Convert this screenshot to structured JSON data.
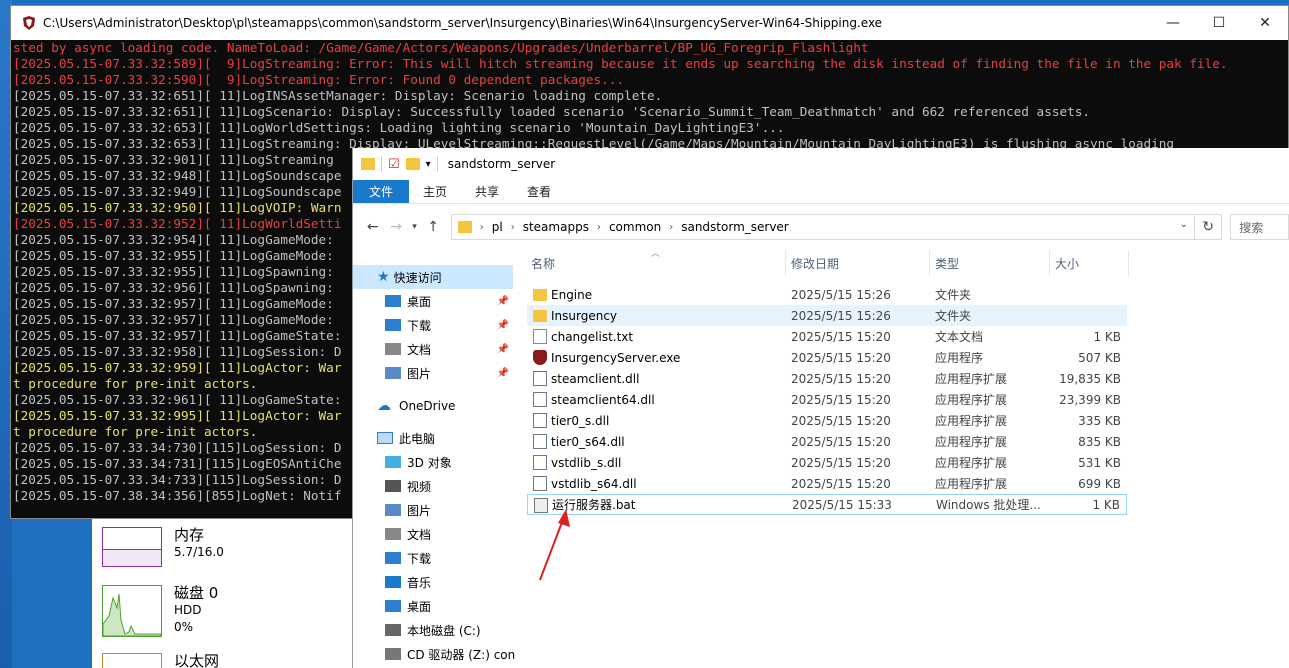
{
  "console": {
    "title": "C:\\Users\\Administrator\\Desktop\\pl\\steamapps\\common\\sandstorm_server\\Insurgency\\Binaries\\Win64\\InsurgencyServer-Win64-Shipping.exe",
    "lines": [
      {
        "t": "sted by async loading code. NameToLoad: /Game/Game/Actors/Weapons/Upgrades/Underbarrel/BP_UG_Foregrip_Flashlight",
        "c": "red"
      },
      {
        "t": "[2025.05.15-07.33.32:589][  9]LogStreaming: Error: This will hitch streaming because it ends up searching the disk instead of finding the file in the pak file.",
        "c": "red"
      },
      {
        "t": "[2025.05.15-07.33.32:590][  9]LogStreaming: Error: Found 0 dependent packages...",
        "c": "red"
      },
      {
        "t": "[2025.05.15-07.33.32:651][ 11]LogINSAssetManager: Display: Scenario loading complete.",
        "c": "white"
      },
      {
        "t": "[2025.05.15-07.33.32:651][ 11]LogScenario: Display: Successfully loaded scenario 'Scenario_Summit_Team_Deathmatch' and 662 referenced assets.",
        "c": "white"
      },
      {
        "t": "[2025.05.15-07.33.32:653][ 11]LogWorldSettings: Loading lighting scenario 'Mountain_DayLightingE3'...",
        "c": "white"
      },
      {
        "t": "[2025.05.15-07.33.32:653][ 11]LogStreaming: Display: ULevelStreaming::RequestLevel(/Game/Maps/Mountain/Mountain_DayLightingE3) is flushing async loading",
        "c": "white"
      },
      {
        "t": "[2025.05.15-07.33.32:901][ 11]LogStreaming",
        "c": "white"
      },
      {
        "t": "[2025.05.15-07.33.32:948][ 11]LogSoundscape",
        "c": "white"
      },
      {
        "t": "[2025.05.15-07.33.32:949][ 11]LogSoundscape",
        "c": "white"
      },
      {
        "t": "[2025.05.15-07.33.32:950][ 11]LogVOIP: Warn",
        "c": "yellow"
      },
      {
        "t": "[2025.05.15-07.33.32:952][ 11]LogWorldSetti",
        "c": "red"
      },
      {
        "t": "[2025.05.15-07.33.32:954][ 11]LogGameMode:",
        "c": "white"
      },
      {
        "t": "[2025.05.15-07.33.32:955][ 11]LogGameMode:",
        "c": "white"
      },
      {
        "t": "[2025.05.15-07.33.32:955][ 11]LogSpawning:",
        "c": "white"
      },
      {
        "t": "[2025.05.15-07.33.32:956][ 11]LogSpawning:",
        "c": "white"
      },
      {
        "t": "[2025.05.15-07.33.32:957][ 11]LogGameMode:",
        "c": "white"
      },
      {
        "t": "[2025.05.15-07.33.32:957][ 11]LogGameMode:",
        "c": "white"
      },
      {
        "t": "[2025.05.15-07.33.32:957][ 11]LogGameState:",
        "c": "white"
      },
      {
        "t": "[2025.05.15-07.33.32:958][ 11]LogSession: D",
        "c": "white"
      },
      {
        "t": "[2025.05.15-07.33.32:959][ 11]LogActor: War",
        "c": "yellow"
      },
      {
        "t": "t procedure for pre-init actors.",
        "c": "yellow"
      },
      {
        "t": "[2025.05.15-07.33.32:961][ 11]LogGameState:",
        "c": "white"
      },
      {
        "t": "[2025.05.15-07.33.32:995][ 11]LogActor: War",
        "c": "yellow"
      },
      {
        "t": "t procedure for pre-init actors.",
        "c": "yellow"
      },
      {
        "t": "[2025.05.15-07.33.34:730][115]LogSession: D",
        "c": "white"
      },
      {
        "t": "[2025.05.15-07.33.34:731][115]LogEOSAntiChe",
        "c": "white"
      },
      {
        "t": "[2025.05.15-07.33.34:733][115]LogSession: D",
        "c": "white"
      },
      {
        "t": "[2025.05.15-07.38.34:356][855]LogNet: Notif",
        "c": "white"
      }
    ]
  },
  "taskmgr": {
    "memory_label": "内存",
    "memory_value": "5.7/16.0",
    "disk_label": "磁盘 0",
    "disk_type": "HDD",
    "disk_value": "0%",
    "net_label": "以太网"
  },
  "explorer": {
    "title": "sandstorm_server",
    "ribbon_tabs": [
      "文件",
      "主页",
      "共享",
      "查看"
    ],
    "breadcrumb": [
      "pl",
      "steamapps",
      "common",
      "sandstorm_server"
    ],
    "search_placeholder": "搜索",
    "nav": {
      "quick_access": "快速访问",
      "quick_items": [
        "桌面",
        "下载",
        "文档",
        "图片"
      ],
      "onedrive": "OneDrive",
      "this_pc": "此电脑",
      "pc_items": [
        "3D 对象",
        "视频",
        "图片",
        "文档",
        "下载",
        "音乐",
        "桌面",
        "本地磁盘 (C:)",
        "CD 驱动器 (Z:) con"
      ]
    },
    "columns": {
      "name": "名称",
      "date": "修改日期",
      "type": "类型",
      "size": "大小"
    },
    "files": [
      {
        "name": "Engine",
        "date": "2025/5/15 15:26",
        "type": "文件夹",
        "size": "",
        "kind": "folder"
      },
      {
        "name": "Insurgency",
        "date": "2025/5/15 15:26",
        "type": "文件夹",
        "size": "",
        "kind": "folder"
      },
      {
        "name": "changelist.txt",
        "date": "2025/5/15 15:20",
        "type": "文本文档",
        "size": "1 KB",
        "kind": "txt"
      },
      {
        "name": "InsurgencyServer.exe",
        "date": "2025/5/15 15:20",
        "type": "应用程序",
        "size": "507 KB",
        "kind": "exe"
      },
      {
        "name": "steamclient.dll",
        "date": "2025/5/15 15:20",
        "type": "应用程序扩展",
        "size": "19,835 KB",
        "kind": "dll"
      },
      {
        "name": "steamclient64.dll",
        "date": "2025/5/15 15:20",
        "type": "应用程序扩展",
        "size": "23,399 KB",
        "kind": "dll"
      },
      {
        "name": "tier0_s.dll",
        "date": "2025/5/15 15:20",
        "type": "应用程序扩展",
        "size": "335 KB",
        "kind": "dll"
      },
      {
        "name": "tier0_s64.dll",
        "date": "2025/5/15 15:20",
        "type": "应用程序扩展",
        "size": "835 KB",
        "kind": "dll"
      },
      {
        "name": "vstdlib_s.dll",
        "date": "2025/5/15 15:20",
        "type": "应用程序扩展",
        "size": "531 KB",
        "kind": "dll"
      },
      {
        "name": "vstdlib_s64.dll",
        "date": "2025/5/15 15:20",
        "type": "应用程序扩展",
        "size": "699 KB",
        "kind": "dll"
      },
      {
        "name": "运行服务器.bat",
        "date": "2025/5/15 15:33",
        "type": "Windows 批处理...",
        "size": "1 KB",
        "kind": "bat"
      }
    ]
  },
  "colors": {
    "accent": "#1979ca",
    "console_red": "#e84040",
    "console_yellow": "#e6e06a",
    "arrow": "#e02020"
  }
}
